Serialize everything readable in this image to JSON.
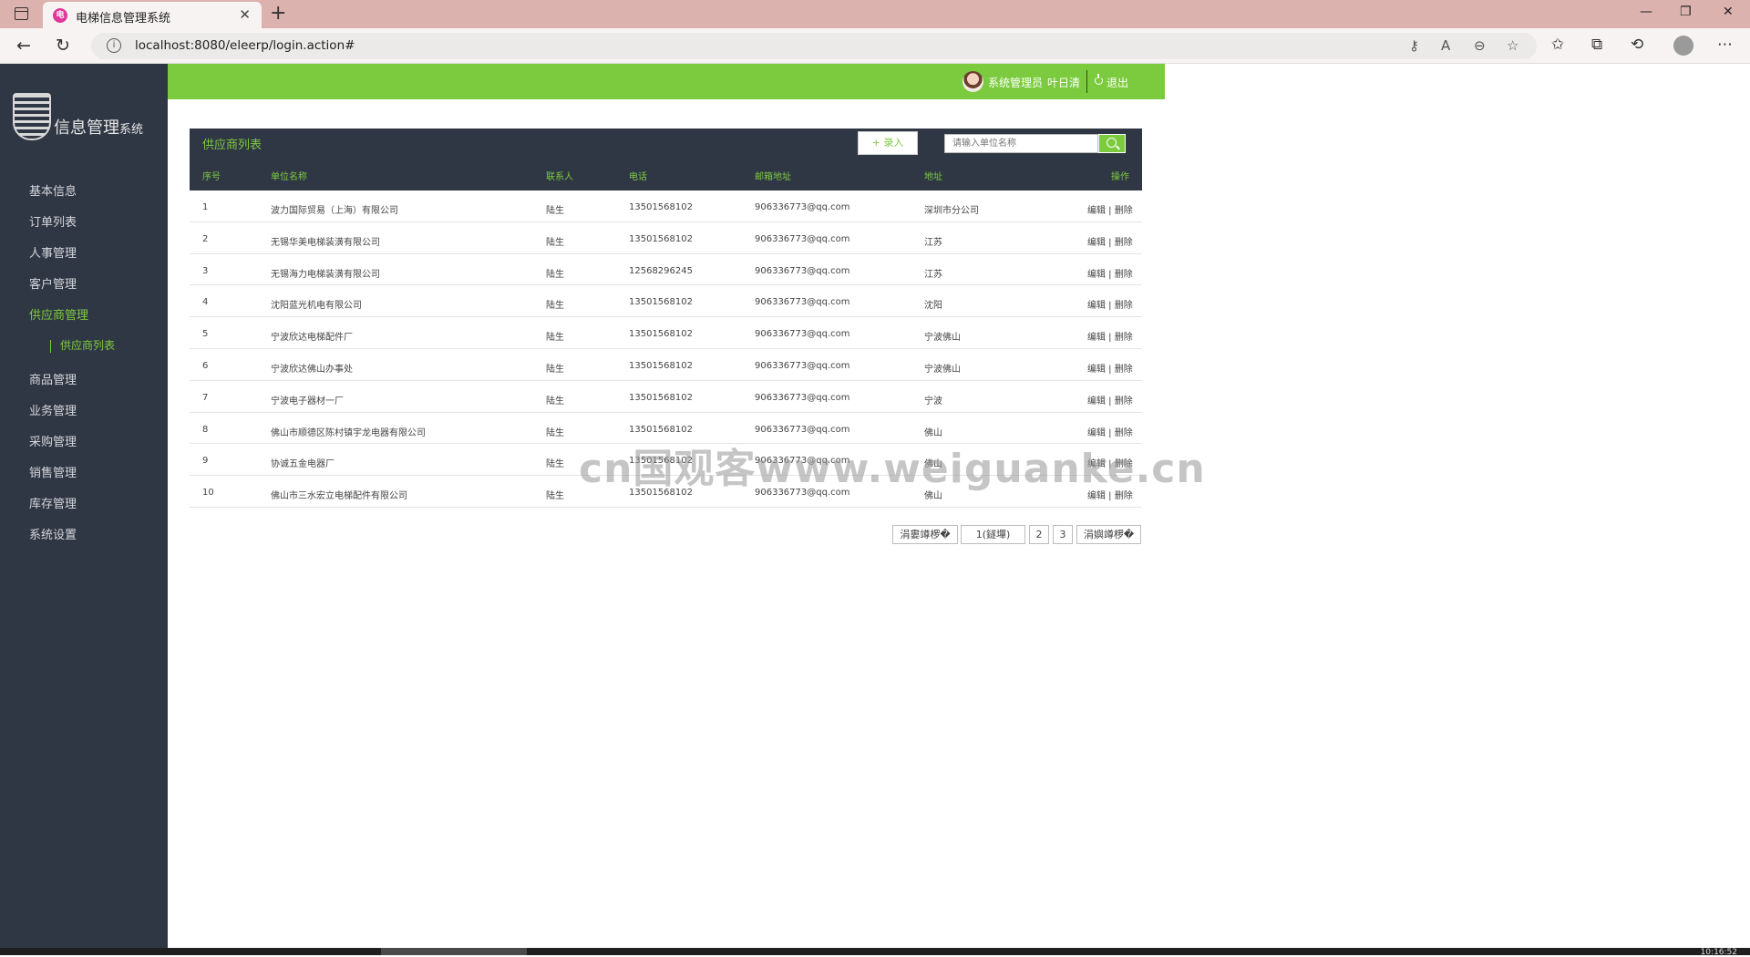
{
  "browser": {
    "tab_title": "电梯信息管理系统",
    "favicon_text": "电",
    "close_glyph": "✕",
    "new_tab_glyph": "+",
    "url": "localhost:8080/eleerp/login.action#"
  },
  "sidebar": {
    "logo_text": "信息管理",
    "logo_small": "系统",
    "logo_mark": "电 IVL",
    "items": [
      {
        "label": "基本信息"
      },
      {
        "label": "订单列表"
      },
      {
        "label": "人事管理"
      },
      {
        "label": "客户管理"
      },
      {
        "label": "供应商管理"
      },
      {
        "label": "商品管理"
      },
      {
        "label": "业务管理"
      },
      {
        "label": "采购管理"
      },
      {
        "label": "销售管理"
      },
      {
        "label": "库存管理"
      },
      {
        "label": "系统设置"
      }
    ],
    "submenu": {
      "label": "供应商列表"
    }
  },
  "header": {
    "role": "系统管理员",
    "user": "叶日清",
    "logout": "退出"
  },
  "panel": {
    "title": "供应商列表",
    "add_label": "+ 录入",
    "search_placeholder": "请输入单位名称",
    "columns": [
      "序号",
      "单位名称",
      "联系人",
      "电话",
      "邮箱地址",
      "地址",
      "操作"
    ],
    "rows": [
      {
        "no": "1",
        "name": "波力国际贸易（上海）有限公司",
        "contact": "陆生",
        "phone": "13501568102",
        "email": "906336773@qq.com",
        "address": "深圳市分公司",
        "ops": "编辑 | 删除"
      },
      {
        "no": "2",
        "name": "无锡华美电梯装潢有限公司",
        "contact": "陆生",
        "phone": "13501568102",
        "email": "906336773@qq.com",
        "address": "江苏",
        "ops": "编辑 | 删除"
      },
      {
        "no": "3",
        "name": "无锡海力电梯装潢有限公司",
        "contact": "陆生",
        "phone": "12568296245",
        "email": "906336773@qq.com",
        "address": "江苏",
        "ops": "编辑 | 删除"
      },
      {
        "no": "4",
        "name": "沈阳蓝光机电有限公司",
        "contact": "陆生",
        "phone": "13501568102",
        "email": "906336773@qq.com",
        "address": "沈阳",
        "ops": "编辑 | 删除"
      },
      {
        "no": "5",
        "name": "宁波欣达电梯配件厂",
        "contact": "陆生",
        "phone": "13501568102",
        "email": "906336773@qq.com",
        "address": "宁波佛山",
        "ops": "编辑 | 删除"
      },
      {
        "no": "6",
        "name": "宁波欣达佛山办事处",
        "contact": "陆生",
        "phone": "13501568102",
        "email": "906336773@qq.com",
        "address": "宁波佛山",
        "ops": "编辑 | 删除"
      },
      {
        "no": "7",
        "name": "宁波电子器材一厂",
        "contact": "陆生",
        "phone": "13501568102",
        "email": "906336773@qq.com",
        "address": "宁波",
        "ops": "编辑 | 删除"
      },
      {
        "no": "8",
        "name": "佛山市顺德区陈村镇宇龙电器有限公司",
        "contact": "陆生",
        "phone": "13501568102",
        "email": "906336773@qq.com",
        "address": "佛山",
        "ops": "编辑 | 删除"
      },
      {
        "no": "9",
        "name": "协诚五金电器厂",
        "contact": "陆生",
        "phone": "13501568102",
        "email": "906336773@qq.com",
        "address": "佛山",
        "ops": "编辑 | 删除"
      },
      {
        "no": "10",
        "name": "佛山市三水宏立电梯配件有限公司",
        "contact": "陆生",
        "phone": "13501568102",
        "email": "906336773@qq.com",
        "address": "佛山",
        "ops": "编辑 | 删除"
      }
    ]
  },
  "pager": {
    "prev": "涓婁竴椤�",
    "current": "1(鐩墠)",
    "pages": [
      "2",
      "3"
    ],
    "next": "涓嬩竴椤�"
  },
  "watermark": "cn国观客www.weiguanke.cn",
  "clock": "10:16:52",
  "colors": {
    "accent": "#7ccb3f",
    "sidebar": "#303744",
    "tabbar": "#dcb2ae"
  }
}
